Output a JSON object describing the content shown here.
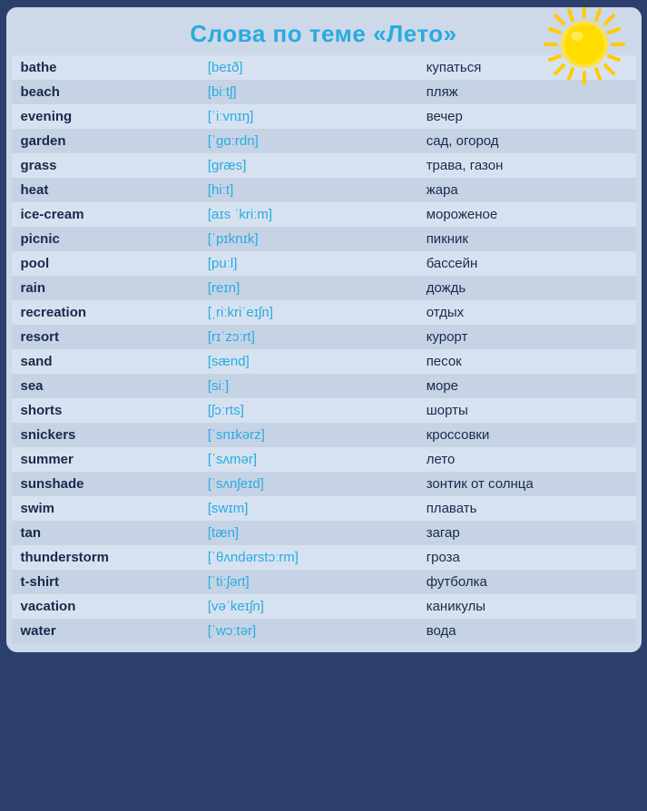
{
  "header": {
    "title": "Слова по теме «Лето»"
  },
  "words": [
    {
      "english": "bathe",
      "transcription": "[beɪð]",
      "russian": "купаться"
    },
    {
      "english": "beach",
      "transcription": "[biːtʃ]",
      "russian": "пляж"
    },
    {
      "english": "evening",
      "transcription": "[ˈiːvnɪŋ]",
      "russian": "вечер"
    },
    {
      "english": "garden",
      "transcription": "[ˈɡɑːrdn]",
      "russian": "сад, огород"
    },
    {
      "english": "grass",
      "transcription": "[ɡræs]",
      "russian": "трава, газон"
    },
    {
      "english": "heat",
      "transcription": "[hiːt]",
      "russian": "жара"
    },
    {
      "english": "ice-cream",
      "transcription": "[aɪs ˈkriːm]",
      "russian": "мороженое"
    },
    {
      "english": "picnic",
      "transcription": "[ˈpɪknɪk]",
      "russian": "пикник"
    },
    {
      "english": "pool",
      "transcription": "[puːl]",
      "russian": "бассейн"
    },
    {
      "english": "rain",
      "transcription": "[reɪn]",
      "russian": "дождь"
    },
    {
      "english": "recreation",
      "transcription": "[ˌriːkriˈeɪʃn]",
      "russian": "отдых"
    },
    {
      "english": "resort",
      "transcription": "[rɪˈzɔːrt]",
      "russian": "курорт"
    },
    {
      "english": "sand",
      "transcription": "[sænd]",
      "russian": "песок"
    },
    {
      "english": "sea",
      "transcription": "[siː]",
      "russian": "море"
    },
    {
      "english": "shorts",
      "transcription": "[ʃɔːrts]",
      "russian": "шорты"
    },
    {
      "english": "snickers",
      "transcription": "[ˈsnɪkərz]",
      "russian": "кроссовки"
    },
    {
      "english": "summer",
      "transcription": "[ˈsʌmər]",
      "russian": "лето"
    },
    {
      "english": "sunshade",
      "transcription": "[ˈsʌnʃeɪd]",
      "russian": "зонтик от солнца"
    },
    {
      "english": "swim",
      "transcription": "[swɪm]",
      "russian": "плавать"
    },
    {
      "english": "tan",
      "transcription": "[tæn]",
      "russian": "загар"
    },
    {
      "english": "thunderstorm",
      "transcription": "[ˈθʌndərstɔːrm]",
      "russian": "гроза"
    },
    {
      "english": "t-shirt",
      "transcription": "[ˈtiːʃərt]",
      "russian": "футболка"
    },
    {
      "english": "vacation",
      "transcription": "[vəˈkeɪʃn]",
      "russian": "каникулы"
    },
    {
      "english": "water",
      "transcription": "[ˈwɔːtər]",
      "russian": "вода"
    }
  ]
}
